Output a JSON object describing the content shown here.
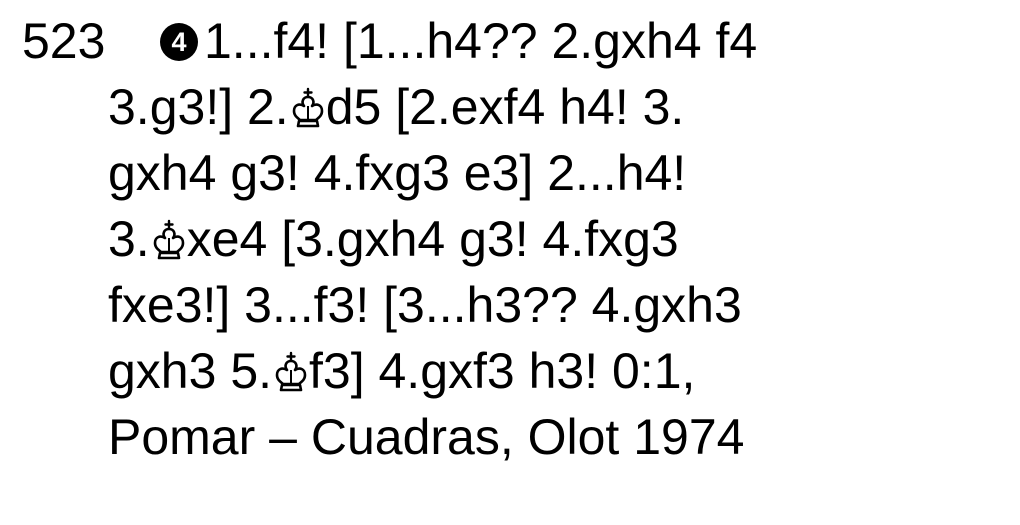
{
  "problem": {
    "number": "523",
    "marker": "4",
    "icons": {
      "king": "white-king-icon"
    },
    "lines": {
      "line1": "1...f4! [1...h4?? 2.gxh4 f4",
      "line2_before_king": "3.g3!] 2.",
      "line2_after_king": "d5 [2.exf4 h4! 3.",
      "line3": "gxh4 g3! 4.fxg3 e3] 2...h4!",
      "line4_before_king": "3.",
      "line4_after_king": "xe4 [3.gxh4 g3!  4.fxg3",
      "line5": "fxe3!] 3...f3! [3...h3?? 4.gxh3",
      "line6_before_king": "gxh3 5.",
      "line6_after_king": "f3] 4.gxf3 h3! 0:1,",
      "line7": "Pomar – Cuadras, Olot 1974"
    }
  }
}
